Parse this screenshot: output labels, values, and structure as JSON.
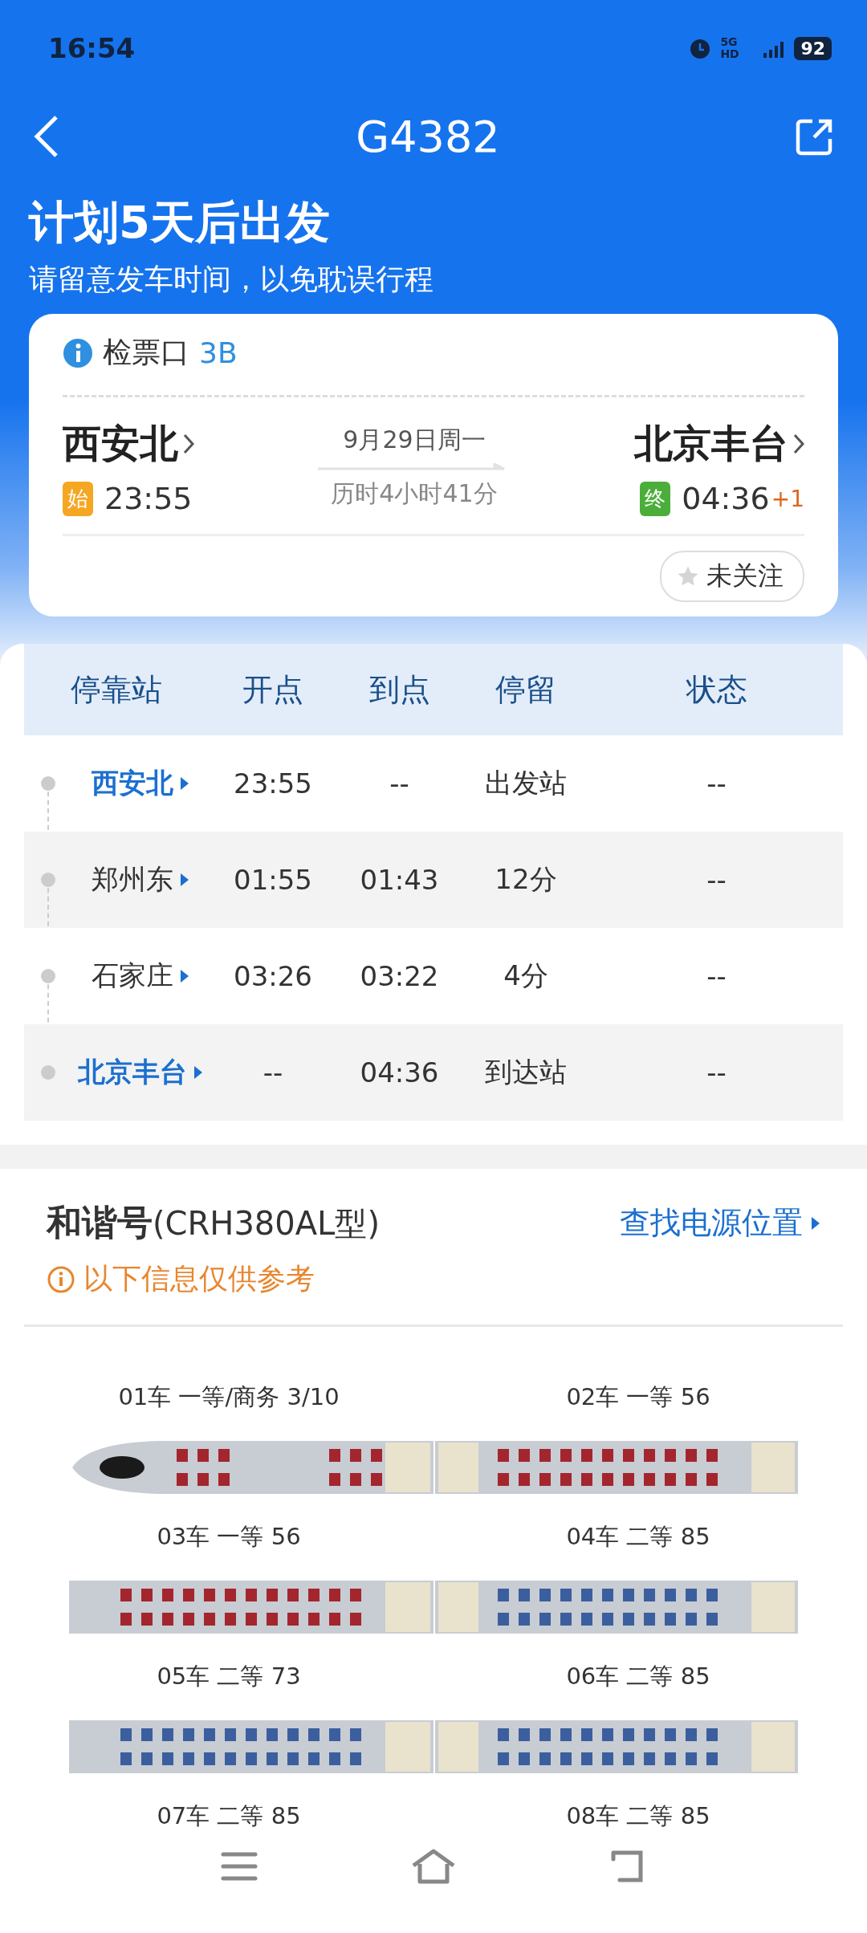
{
  "status_bar": {
    "time": "16:54",
    "network": "5G HD",
    "battery": "92"
  },
  "nav": {
    "title": "G4382"
  },
  "headline": {
    "title": "计划5天后出发",
    "subtitle": "请留意发车时间，以免耽误行程"
  },
  "trip": {
    "gate_label": "检票口",
    "gate": "3B",
    "from": {
      "station": "西安北",
      "tag": "始",
      "time": "23:55"
    },
    "date": "9月29日周一",
    "duration": "历时4小时41分",
    "to": {
      "station": "北京丰台",
      "tag": "终",
      "time": "04:36",
      "day_offset": "+1"
    },
    "follow": {
      "label": "未关注",
      "followed": false
    }
  },
  "stops_table": {
    "columns": [
      "停靠站",
      "开点",
      "到点",
      "停留",
      "状态"
    ],
    "rows": [
      {
        "station": "西安北",
        "depart": "23:55",
        "arrive": "--",
        "stay": "出发站",
        "status": "--",
        "endpoint": true
      },
      {
        "station": "郑州东",
        "depart": "01:55",
        "arrive": "01:43",
        "stay": "12分",
        "status": "--",
        "endpoint": false
      },
      {
        "station": "石家庄",
        "depart": "03:26",
        "arrive": "03:22",
        "stay": "4分",
        "status": "--",
        "endpoint": false
      },
      {
        "station": "北京丰台",
        "depart": "--",
        "arrive": "04:36",
        "stay": "到达站",
        "status": "--",
        "endpoint": true
      }
    ]
  },
  "train": {
    "model": "和谐号",
    "model_code": "(CRH380AL型)",
    "power_link": "查找电源位置",
    "note": "以下信息仅供参考",
    "coaches": [
      {
        "label": "01车 一等/商务 3/10"
      },
      {
        "label": "02车 一等 56"
      },
      {
        "label": "03车 一等 56"
      },
      {
        "label": "04车 二等 85"
      },
      {
        "label": "05车 二等 73"
      },
      {
        "label": "06车 二等 85"
      },
      {
        "label": "07车 二等 85"
      },
      {
        "label": "08车 二等 85"
      }
    ]
  }
}
